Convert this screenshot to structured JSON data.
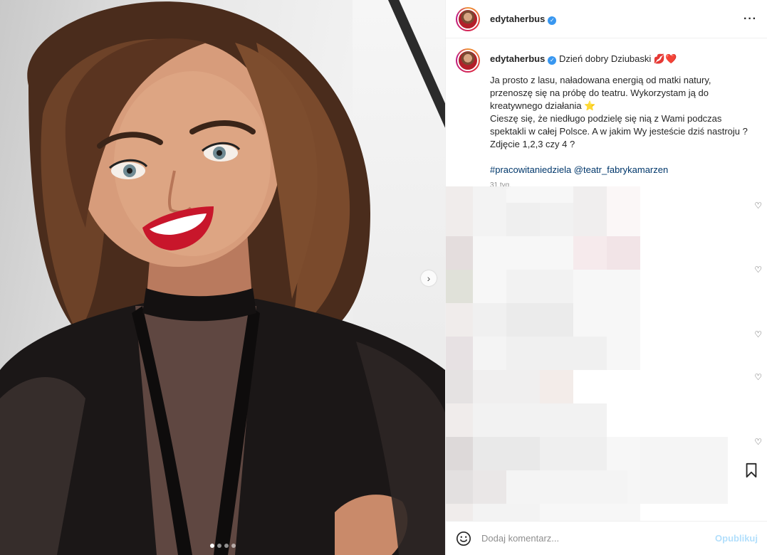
{
  "post": {
    "username": "edytaherbus",
    "verified_icon": "verified-badge-icon",
    "more_icon": "more-options-icon"
  },
  "photo": {
    "description_icon": "photo-image",
    "next_icon": "chevron-right-icon",
    "carousel_count": 4,
    "carousel_active": 1
  },
  "caption": {
    "username": "edytaherbus",
    "first_line": "Dzień dobry Dziubaski 💋❤️",
    "body": "Ja prosto z lasu, naładowana energią od matki natury, przenoszę się na próbę do teatru. Wykorzystam ją do kreatywnego działania ⭐\nCieszę się, że niedługo podzielę się nią z Wami podczas spektakli w całej Polsce. A w jakim Wy jesteście dziś nastroju ?\nZdjęcie 1,2,3 czy 4 ?",
    "hashtags": "#pracowitaniedziela @teatr_fabrykamarzen",
    "time": "31 tyg."
  },
  "comment_box": {
    "placeholder": "Dodaj komentarz...",
    "publish_label": "Opublikuj",
    "emoji_icon": "emoji-smiley-icon",
    "bookmark_icon": "bookmark-icon"
  },
  "colors": {
    "link": "#00376b",
    "muted": "#8e8e8e",
    "publish_disabled": "#b2dffc",
    "verified": "#3897f0"
  }
}
